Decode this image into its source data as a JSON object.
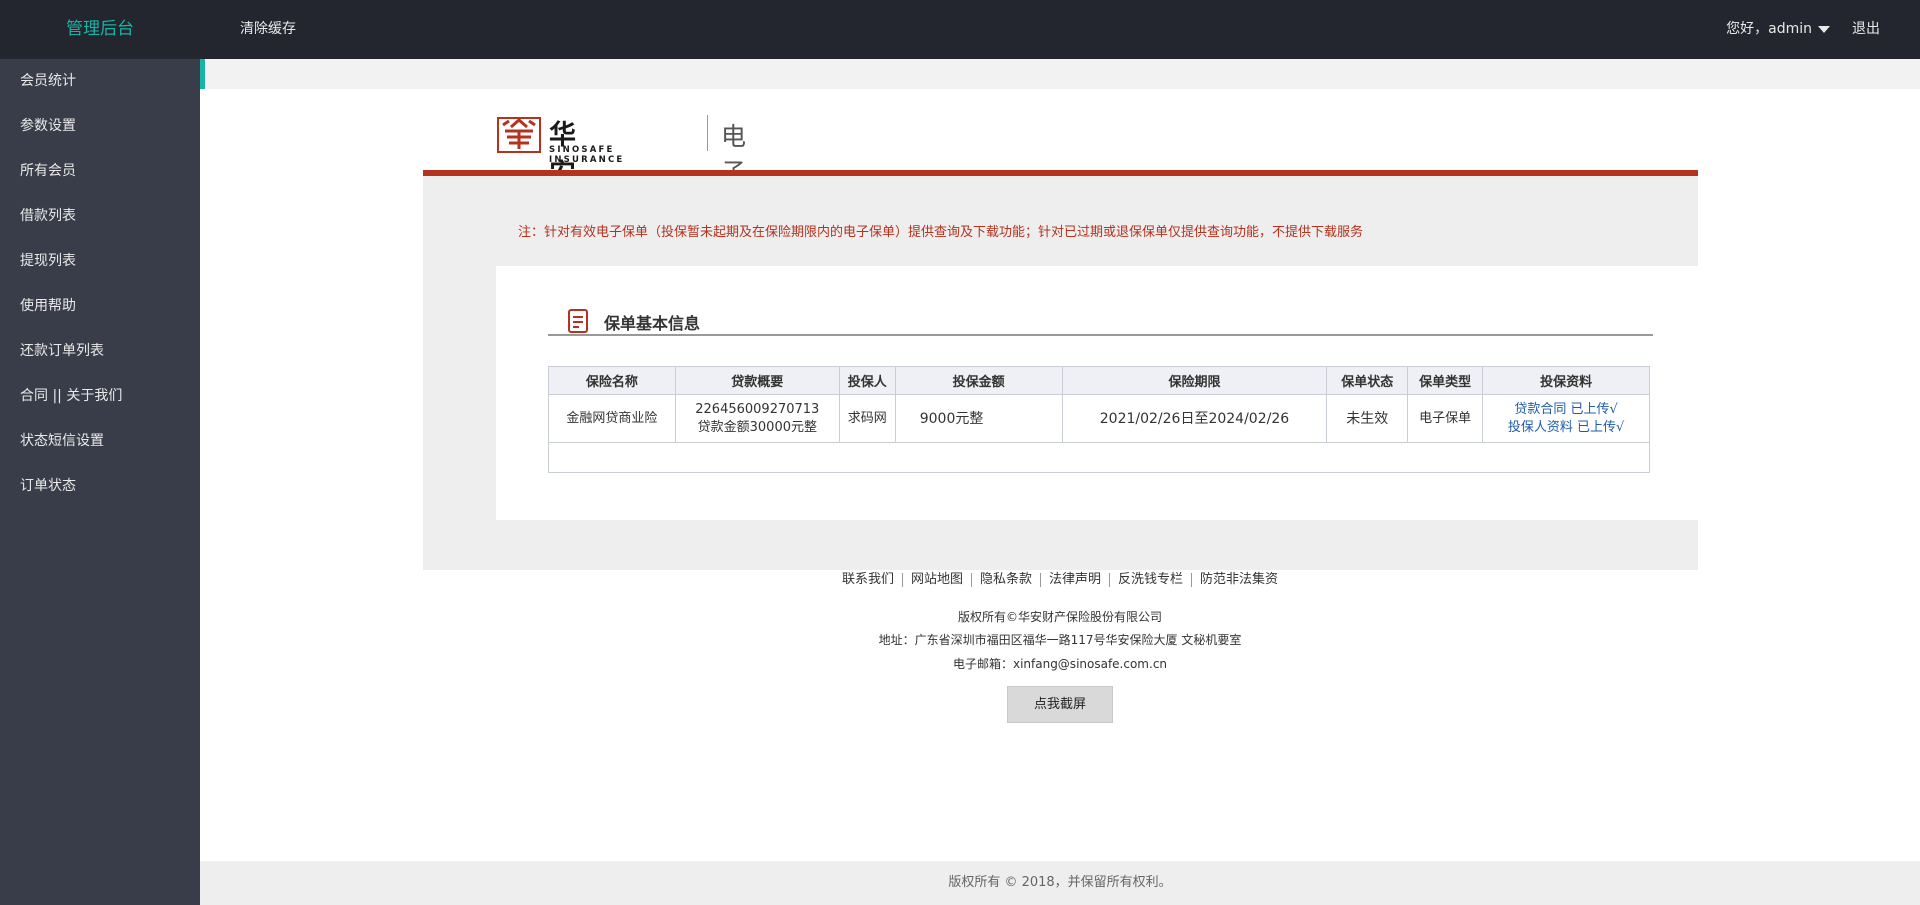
{
  "header": {
    "brand": "管理后台",
    "clear_cache": "清除缓存",
    "greeting": "您好，admin",
    "logout": "退出"
  },
  "sidebar": {
    "items": [
      {
        "label": "会员统计"
      },
      {
        "label": "参数设置"
      },
      {
        "label": "所有会员"
      },
      {
        "label": "借款列表"
      },
      {
        "label": "提现列表"
      },
      {
        "label": "使用帮助"
      },
      {
        "label": "还款订单列表"
      },
      {
        "label": "合同 || 关于我们"
      },
      {
        "label": "状态短信设置"
      },
      {
        "label": "订单状态"
      }
    ]
  },
  "logo": {
    "cn": "华安保险",
    "en": "SINOSAFE INSURANCE",
    "system_title": "电子保单系统"
  },
  "notice": "注：针对有效电子保单（投保暂未起期及在保险期限内的电子保单）提供查询及下载功能；针对已过期或退保保单仅提供查询功能，不提供下载服务",
  "section_title": "保单基本信息",
  "table": {
    "headers": [
      "保险名称",
      "贷款概要",
      "投保人",
      "投保金额",
      "保险期限",
      "保单状态",
      "保单类型",
      "投保资料"
    ],
    "row": {
      "name": "金融网贷商业险",
      "loan_no": "226456009270713",
      "loan_amount": "贷款金额30000元整",
      "applicant": "求码网",
      "amount": "9000元整",
      "period": "2021/02/26日至2024/02/26",
      "status": "未生效",
      "type": "电子保单",
      "doc1": "贷款合同 已上传√",
      "doc2": "投保人资料 已上传√"
    }
  },
  "footer": {
    "links": [
      "联系我们",
      "网站地图",
      "隐私条款",
      "法律声明",
      "反洗钱专栏",
      "防范非法集资"
    ],
    "rights": "版权所有©华安财产保险股份有限公司",
    "address": "地址：广东省深圳市福田区福华一路117号华安保险大厦 文秘机要室",
    "email": "电子邮箱：xinfang@sinosafe.com.cn",
    "screenshot_button": "点我截屏"
  },
  "copyright": "版权所有 © 2018，并保留所有权利。",
  "colors": {
    "topbar": "#23262e",
    "sidebar": "#393d49",
    "brand": "#19b3a5",
    "accent_red": "#b4321e",
    "link_blue": "#1f5ca8"
  }
}
